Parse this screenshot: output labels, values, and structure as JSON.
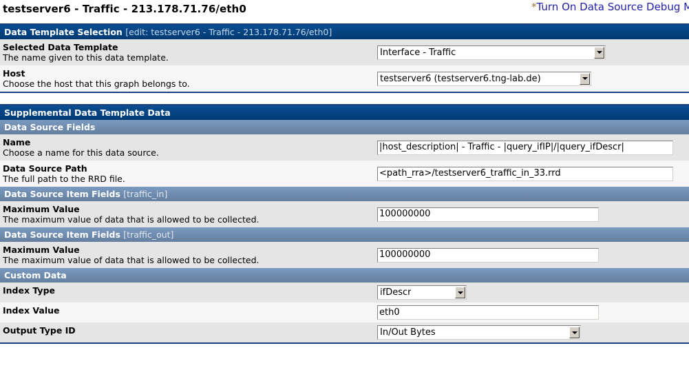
{
  "header": {
    "page_title": "testserver6 - Traffic - 213.178.71.76/eth0",
    "action_asterisk": "*",
    "action_link": "Turn On Data Source Debug Mode"
  },
  "template_section": {
    "title": "Data Template Selection",
    "subtitle": "[edit: testserver6 - Traffic - 213.178.71.76/eth0]",
    "rows": [
      {
        "label": "Selected Data Template",
        "description": "The name given to this data template.",
        "control": "select",
        "value": "Interface - Traffic"
      },
      {
        "label": "Host",
        "description": "Choose the host that this graph belongs to.",
        "control": "select",
        "value": "testserver6 (testserver6.tng-lab.de)"
      }
    ]
  },
  "supplemental_section": {
    "title": "Supplemental Data Template Data",
    "groups": [
      {
        "title": "Data Source Fields",
        "subtitle": "",
        "rows": [
          {
            "label": "Name",
            "description": "Choose a name for this data source.",
            "control": "text",
            "value": "|host_description| - Traffic - |query_ifIP|/|query_ifDescr|"
          },
          {
            "label": "Data Source Path",
            "description": "The full path to the RRD file.",
            "control": "text",
            "value": "<path_rra>/testserver6_traffic_in_33.rrd"
          }
        ]
      },
      {
        "title": "Data Source Item Fields",
        "subtitle": "[traffic_in]",
        "rows": [
          {
            "label": "Maximum Value",
            "description": "The maximum value of data that is allowed to be collected.",
            "control": "text",
            "value": "100000000"
          }
        ]
      },
      {
        "title": "Data Source Item Fields",
        "subtitle": "[traffic_out]",
        "rows": [
          {
            "label": "Maximum Value",
            "description": "The maximum value of data that is allowed to be collected.",
            "control": "text",
            "value": "100000000"
          }
        ]
      },
      {
        "title": "Custom Data",
        "subtitle": "",
        "rows": [
          {
            "label": "Index Type",
            "description": "",
            "control": "select",
            "value": "ifDescr"
          },
          {
            "label": "Index Value",
            "description": "",
            "control": "text",
            "value": "eth0"
          },
          {
            "label": "Output Type ID",
            "description": "",
            "control": "select",
            "value": "In/Out Bytes"
          }
        ]
      }
    ]
  },
  "colors": {
    "bar_dark": "#00427f",
    "bar_mid": "#6d8fb8",
    "row_shade_a": "#e5e5e5",
    "row_shade_b": "#f6f6f6",
    "link": "#1f1fa8",
    "border": "#19407c"
  }
}
